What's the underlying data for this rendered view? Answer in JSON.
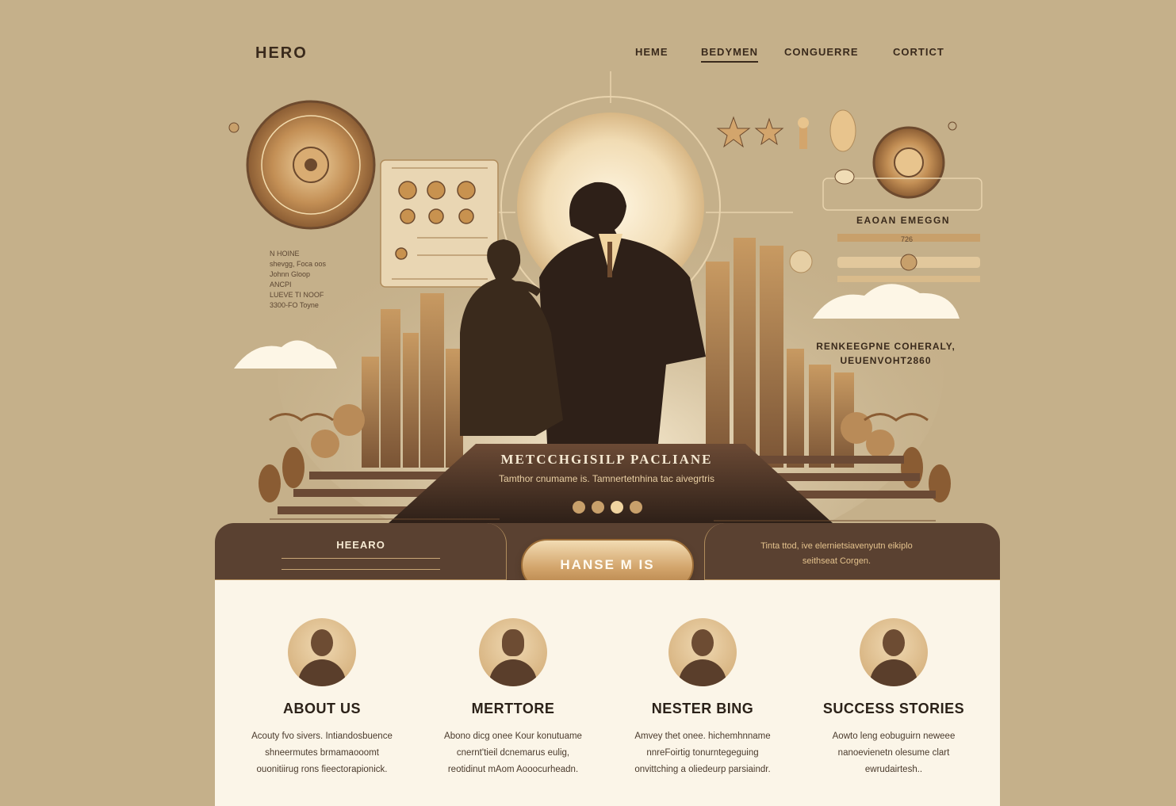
{
  "header": {
    "logo": "HERO",
    "nav": [
      "HEME",
      "BEDYMEN",
      "CONGUERRE",
      "CORTICT"
    ],
    "active_nav": "BEDYMEN"
  },
  "hero": {
    "title": "METCCHGISILP PACLIANE",
    "subtitle": "Tamthor cnumame is. Tamnertetnhina tac aivegrtris",
    "panel_right_title": "EAOAN EMEGGN",
    "panel_right_num": "726",
    "panel_left_lines": [
      "N HOINE",
      "shevgg, Foca oos",
      "Johnn Gloop",
      "ANCPI",
      "LUEVE TI NOOF",
      "3300-FO Toyne"
    ],
    "side_text": [
      "RENKEEGPNE COHERALY,",
      "UEUENVOHT2860"
    ],
    "carousel_dots": 4,
    "carousel_active": 2
  },
  "bar": {
    "left_label": "HEEARO",
    "cta_label": "HANSE M IS",
    "right_text": [
      "Tinta ttod, ive elernietsiavenyutn eikiplo",
      "seithseat Corgen."
    ]
  },
  "cards": [
    {
      "title": "ABOUT US",
      "lines": [
        "Acouty fvo sivers. Intiandosbuence",
        "shneermutes brmamaooomt",
        "ouonitiirug rons fieectorapionick."
      ]
    },
    {
      "title": "MERTTORE",
      "lines": [
        "Abono dicg onee Kour konutuame",
        "cnernt'tieil dcnemarus eulig,",
        "reotidinut mAom Aooocurheadn."
      ]
    },
    {
      "title": "NESTER BING",
      "lines": [
        "Amvey thet onee. hichemhnname",
        "nnreFoirtig tonurntegeguing",
        "onvittching a oliedeurp parsiaindr."
      ]
    },
    {
      "title": "SUCCESS STORIES",
      "lines": [
        "Aowto leng eobuguirn neweee",
        "nanoevienetn olesume clart",
        "ewrudairtesh.."
      ]
    }
  ],
  "colors": {
    "background": "#c5b08a",
    "dark_bar": "#5a4131",
    "accent_gold": "#c8a06b",
    "cards_bg": "#fbf5e8"
  }
}
